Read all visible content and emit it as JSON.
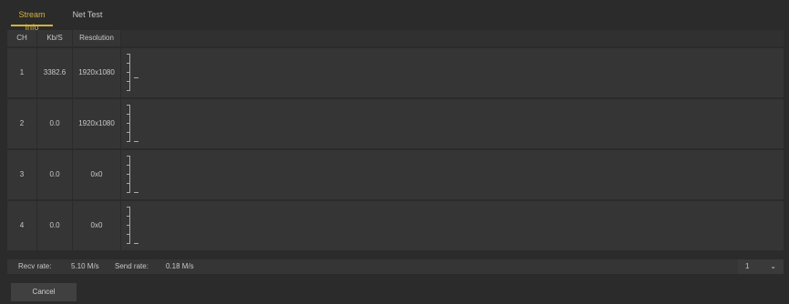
{
  "tabs": [
    {
      "label": "Stream Info",
      "active": true
    },
    {
      "label": "Net Test",
      "active": false
    }
  ],
  "table": {
    "headers": [
      "CH",
      "Kb/S",
      "Resolution",
      ""
    ],
    "rows": [
      {
        "ch": "1",
        "kbs": "3382.6",
        "resolution": "1920x1080"
      },
      {
        "ch": "2",
        "kbs": "0.0",
        "resolution": "1920x1080"
      },
      {
        "ch": "3",
        "kbs": "0.0",
        "resolution": "0x0"
      },
      {
        "ch": "4",
        "kbs": "0.0",
        "resolution": "0x0"
      }
    ]
  },
  "status": {
    "recv_label": "Recv rate:",
    "recv_value": "5.10 M/s",
    "send_label": "Send rate:",
    "send_value": "0.18 M/s",
    "select_value": "1"
  },
  "actions": {
    "cancel_label": "Cancel"
  },
  "colors": {
    "accent": "#d4b23c",
    "background": "#2b2b2b",
    "panel": "#353535"
  }
}
